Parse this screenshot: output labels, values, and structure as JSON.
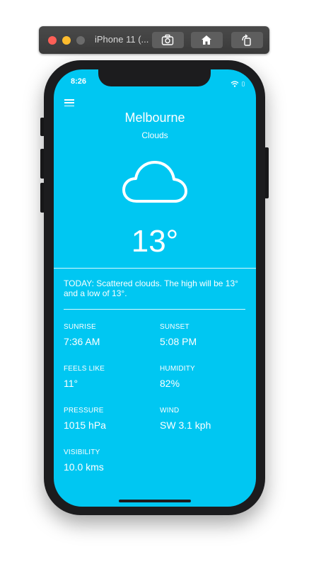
{
  "simulator": {
    "title": "iPhone 11 (...",
    "buttons": [
      "screenshot-icon",
      "home-icon",
      "rotate-icon"
    ]
  },
  "status_bar": {
    "time": "8:26"
  },
  "weather": {
    "city": "Melbourne",
    "condition": "Clouds",
    "icon": "cloud-icon",
    "temperature": "13°",
    "summary": "TODAY: Scattered clouds. The high will be 13° and a low of 13°."
  },
  "details": {
    "sunrise": {
      "label": "SUNRISE",
      "value": "7:36 AM"
    },
    "sunset": {
      "label": "SUNSET",
      "value": "5:08 PM"
    },
    "feels_like": {
      "label": "FEELS LIKE",
      "value": "11°"
    },
    "humidity": {
      "label": "HUMIDITY",
      "value": "82%"
    },
    "pressure": {
      "label": "PRESSURE",
      "value": "1015 hPa"
    },
    "wind": {
      "label": "WIND",
      "value": "SW 3.1 kph"
    },
    "visibility": {
      "label": "VISIBILITY",
      "value": "10.0 kms"
    }
  },
  "colors": {
    "background": "#00c7f2",
    "text": "#ffffff",
    "frame": "#1c1c1e"
  }
}
